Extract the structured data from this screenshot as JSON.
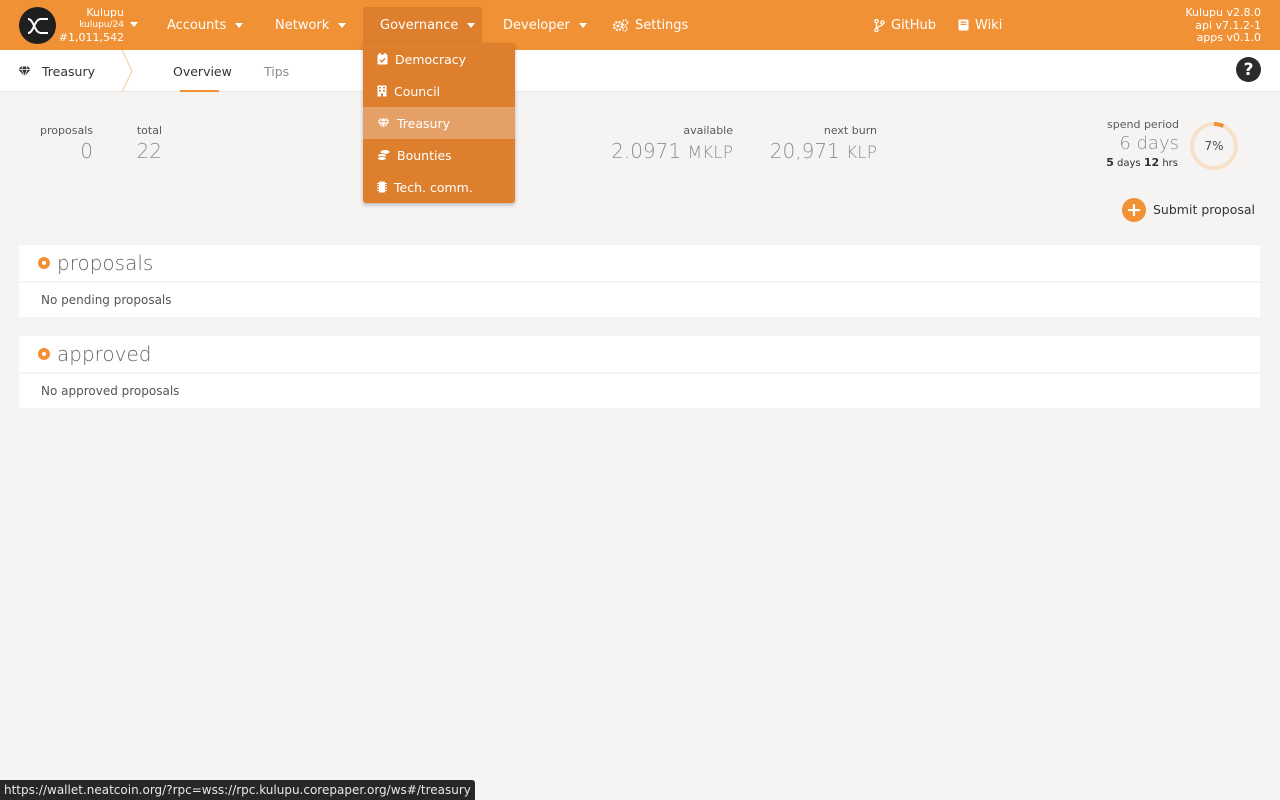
{
  "chain": {
    "name": "Kulupu",
    "spec": "kulupu/24",
    "block": "#1,011,542"
  },
  "nav": {
    "accounts": "Accounts",
    "network": "Network",
    "governance": "Governance",
    "developer": "Developer",
    "settings": "Settings",
    "github": "GitHub",
    "wiki": "Wiki"
  },
  "versions": {
    "node": "Kulupu v2.8.0",
    "api": "api v7.1.2-1",
    "apps": "apps v0.1.0"
  },
  "governance_menu": [
    {
      "label": "Democracy",
      "icon": "calendar-check-icon"
    },
    {
      "label": "Council",
      "icon": "building-icon"
    },
    {
      "label": "Treasury",
      "icon": "gem-icon",
      "selected": true
    },
    {
      "label": "Bounties",
      "icon": "coins-icon"
    },
    {
      "label": "Tech. comm.",
      "icon": "microchip-icon"
    }
  ],
  "breadcrumb": {
    "label": "Treasury",
    "icon": "gem-icon"
  },
  "tabs": [
    {
      "label": "Overview",
      "active": true
    },
    {
      "label": "Tips",
      "active": false
    }
  ],
  "summary": {
    "proposals_label": "proposals",
    "proposals_value": "0",
    "total_label": "total",
    "total_value": "22",
    "available_label": "available",
    "available_value": "2.0971",
    "available_unit": "MKLP",
    "next_burn_label": "next burn",
    "next_burn_value": "20,971",
    "next_burn_unit": "KLP",
    "spend_period_label": "spend period",
    "spend_period_value": "6 days",
    "spend_remaining_days": "5",
    "spend_remaining_days_unit": "days",
    "spend_remaining_hrs": "12",
    "spend_remaining_hrs_unit": "hrs",
    "spend_progress_label": "7%",
    "spend_progress": 0.07
  },
  "submit_label": "Submit proposal",
  "sections": {
    "proposals_title": "proposals",
    "proposals_empty": "No pending proposals",
    "approved_title": "approved",
    "approved_empty": "No approved proposals"
  },
  "status_url": "https://wallet.neatcoin.org/?rpc=wss://rpc.kulupu.corepaper.org/ws#/treasury",
  "colors": {
    "accent": "#f19135",
    "accent_dark": "#dd7f2c",
    "logo_bg": "#1f1f1f"
  }
}
